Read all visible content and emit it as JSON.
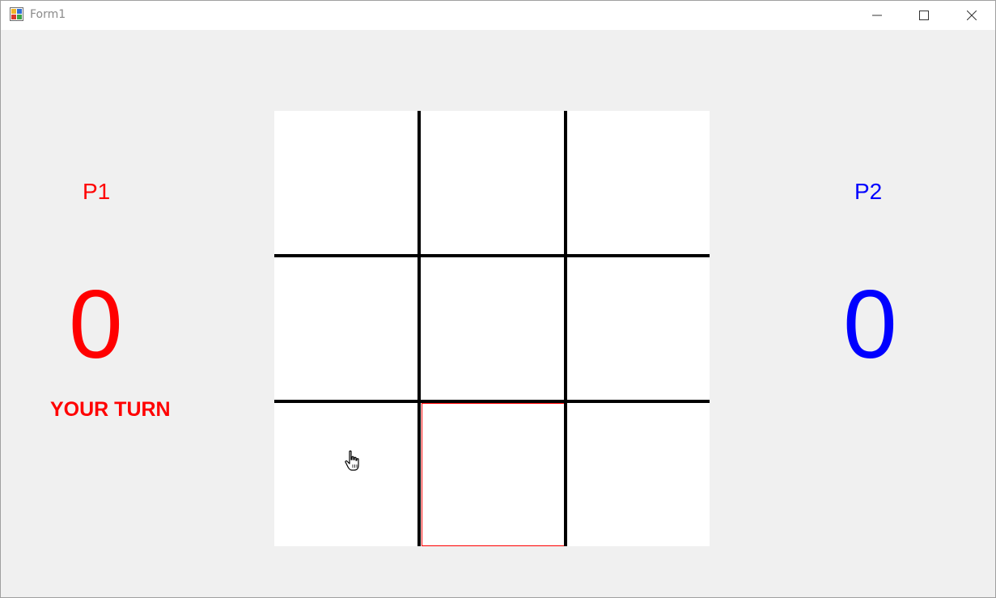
{
  "window": {
    "title": "Form1",
    "icons": {
      "app": "form-app-icon",
      "minimize": "minimize-icon",
      "maximize": "maximize-icon",
      "close": "close-icon"
    }
  },
  "players": {
    "p1": {
      "label": "P1",
      "score": "0",
      "color": "#ff0000"
    },
    "p2": {
      "label": "P2",
      "score": "0",
      "color": "#0000ff"
    }
  },
  "status": {
    "turn_text": "YOUR TURN"
  },
  "board": {
    "rows": 3,
    "cols": 3,
    "cells": [
      "",
      "",
      "",
      "",
      "",
      "",
      "",
      "",
      ""
    ],
    "highlighted_cell": 7,
    "highlight_color": "#ff0000",
    "cursor": "hand-pointer-icon"
  }
}
